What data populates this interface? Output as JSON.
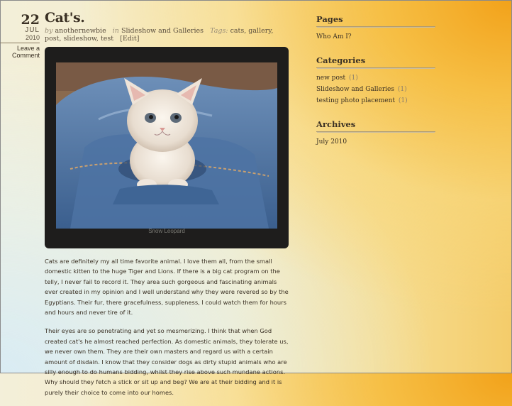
{
  "post": {
    "day": "22",
    "month": "JUL",
    "year": "2010",
    "leave_comment": "Leave a Comment",
    "title": "Cat's.",
    "by_label": "by",
    "author": "anothernewbie",
    "in_label": "in",
    "category": "Slideshow and Galleries",
    "tags_label": "Tags:",
    "tags": "cats, gallery, post, slideshow, test",
    "edit": "[Edit]",
    "image_caption": "Snow Leopard",
    "paragraphs": [
      "Cats are  definitely my all time favorite animal. I love them all, from the small  domestic kitten to the huge Tiger and Lions. If there is a big cat program on the telly, I never fail to record it. They area such gorgeous and fascinating animals ever created in my opinion and I well understand why they were revered so by the Egyptians. Their fur, there gracefulness, suppleness, I could watch them for hours and hours and never tire of it.",
      "Their eyes are so penetrating and yet so mesmerizing. I think that when God created cat's he almost reached perfection. As domestic animals, they tolerate us, we never own them. They are their own masters and regard us with a certain amount of disdain. I know that they consider dogs as dirty stupid animals who are silly enough to do humans bidding, whilst they rise above such mundane actions. Why should they fetch a stick or sit up and beg?  We are at their bidding and it is purely their choice to come into our homes."
    ]
  },
  "sidebar": {
    "pages_heading": "Pages",
    "pages": [
      {
        "label": "Who Am I?"
      }
    ],
    "categories_heading": "Categories",
    "categories": [
      {
        "label": "new post",
        "count": "(1)"
      },
      {
        "label": "Slideshow and Galleries",
        "count": "(1)"
      },
      {
        "label": "testing photo placement",
        "count": "(1)"
      }
    ],
    "archives_heading": "Archives",
    "archives": [
      {
        "label": "July 2010"
      }
    ]
  }
}
